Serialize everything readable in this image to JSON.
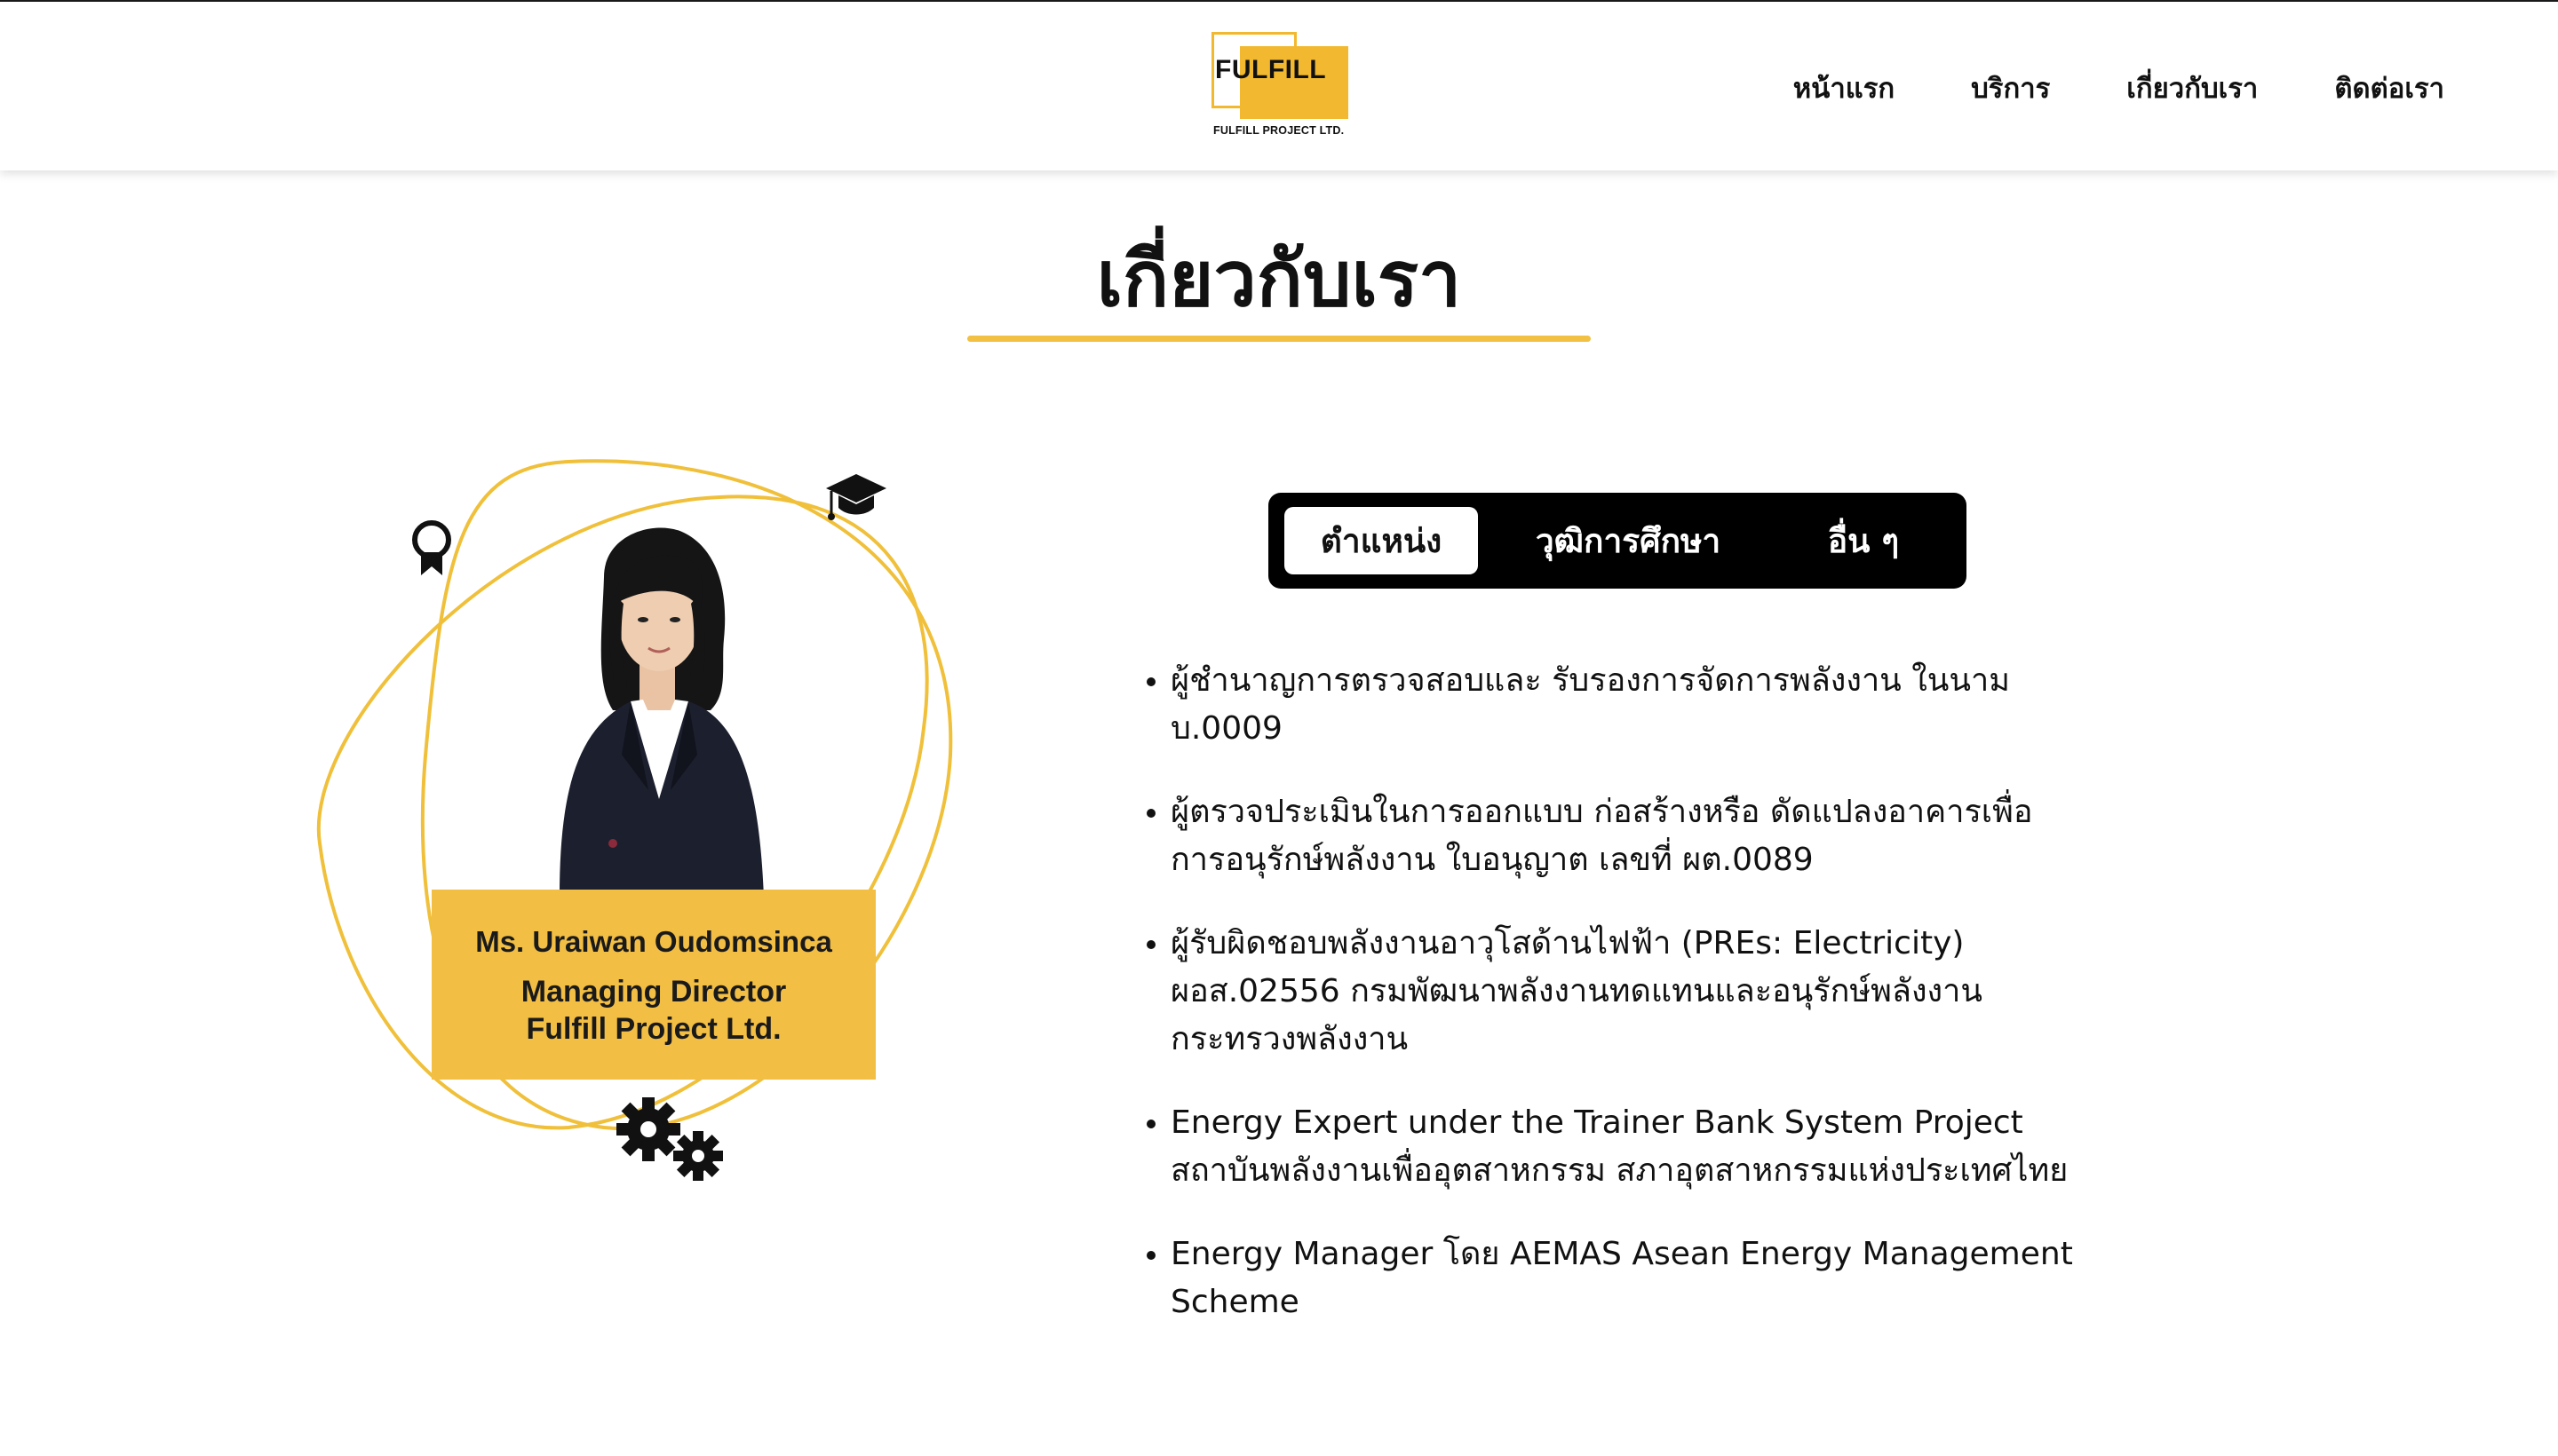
{
  "logo": {
    "word": "FULFILL",
    "subtitle": "FULFILL PROJECT LTD."
  },
  "nav": {
    "items": [
      "หน้าแรก",
      "บริการ",
      "เกี่ยวกับเรา",
      "ติดต่อเรา"
    ]
  },
  "page": {
    "title": "เกี่ยวกับเรา"
  },
  "profile": {
    "name": "Ms. Uraiwan Oudomsinca",
    "title": "Managing Director",
    "company": "Fulfill Project Ltd."
  },
  "tabs": {
    "items": [
      "ตำแหน่ง",
      "วุฒิการศึกษา",
      "อื่น ๆ"
    ],
    "active_index": 0
  },
  "qualifications": [
    "ผู้ชำนาญการตรวจสอบและ รับรองการจัดการพลังงาน ในนาม บ.0009",
    "ผู้ตรวจประเมินในการออกแบบ ก่อสร้างหรือ ดัดแปลงอาคารเพื่อการอนุรักษ์พลังงาน ใบอนุญาต เลขที่ ผต.0089",
    "ผู้รับผิดชอบพลังงานอาวุโสด้านไฟฟ้า (PREs: Electricity) ผอส.02556 กรมพัฒนาพลังงานทดแทนและอนุรักษ์พลังงาน กระทรวงพลังงาน",
    "Energy Expert under the Trainer Bank System Project สถาบันพลังงานเพื่ออุตสาหกรรม สภาอุตสาหกรรมแห่งประเทศไทย",
    "Energy Manager โดย AEMAS Asean Energy Management Scheme"
  ],
  "icons": {
    "award": "award-ribbon-icon",
    "graduation": "graduation-cap-icon",
    "gears": "gears-icon"
  },
  "colors": {
    "accent": "#f2be44",
    "text": "#111111",
    "tab_bar": "#000000"
  }
}
